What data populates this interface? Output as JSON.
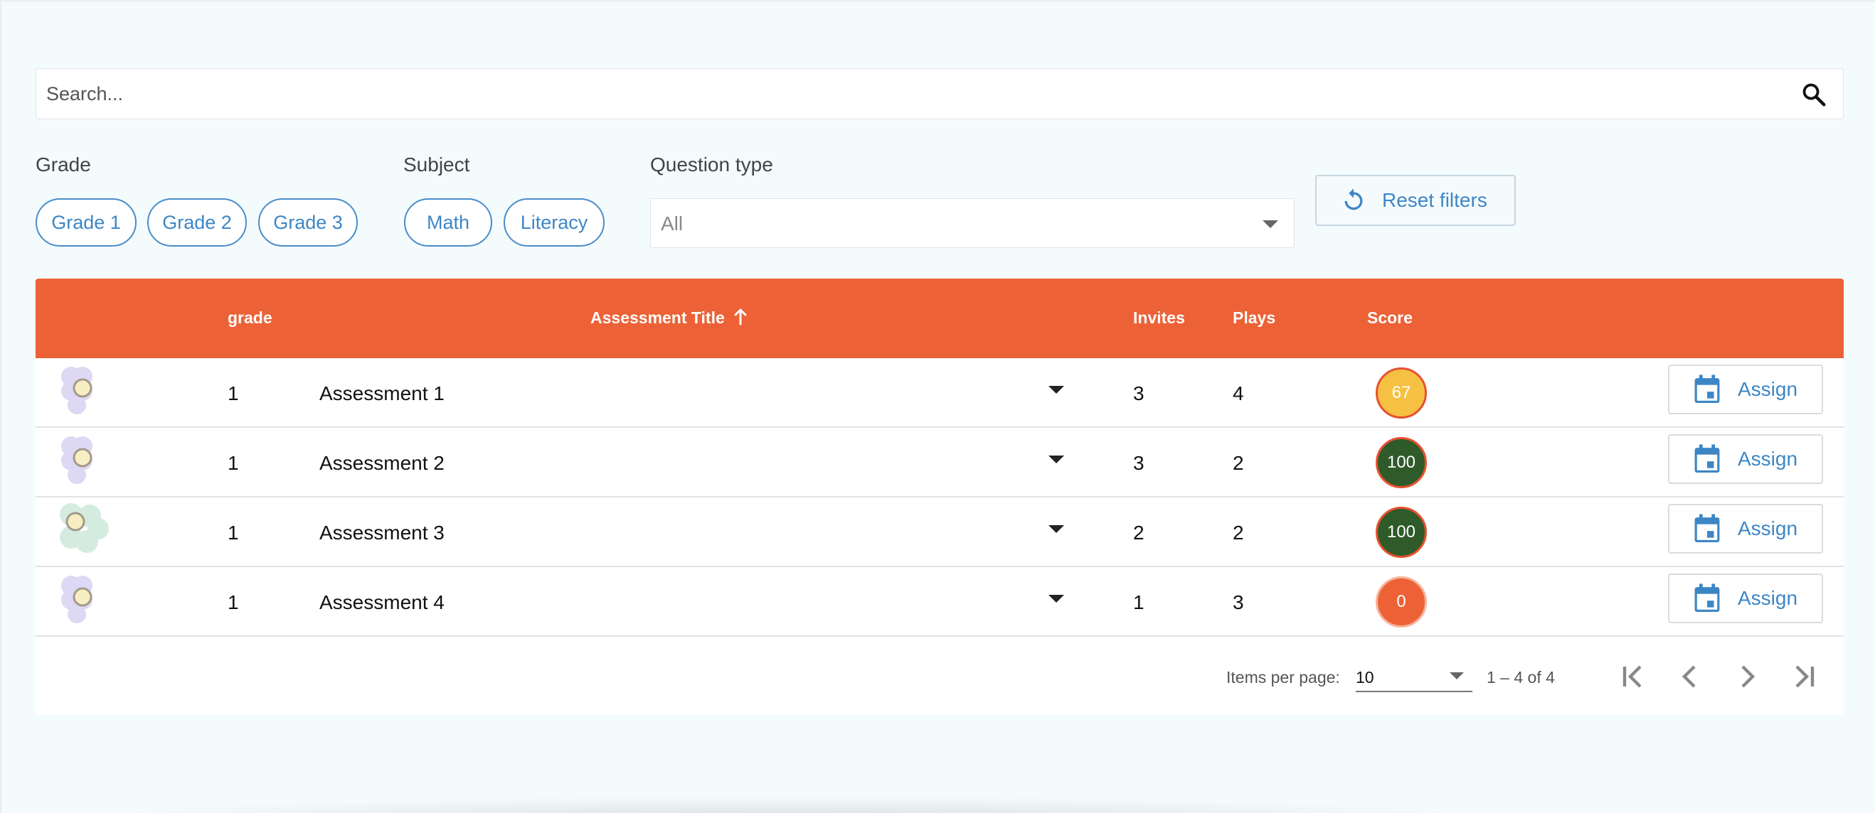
{
  "search": {
    "placeholder": "Search..."
  },
  "filters": {
    "grade": {
      "label": "Grade",
      "chips": [
        "Grade 1",
        "Grade 2",
        "Grade 3"
      ]
    },
    "subject": {
      "label": "Subject",
      "chips": [
        "Math",
        "Literacy"
      ]
    },
    "question_type": {
      "label": "Question type",
      "value": "All"
    },
    "reset_label": "Reset filters"
  },
  "table": {
    "headers": {
      "grade": "grade",
      "title": "Assessment Title",
      "invites": "Invites",
      "plays": "Plays",
      "score": "Score"
    },
    "sort": "ascending",
    "rows": [
      {
        "grade": "1",
        "title": "Assessment 1",
        "invites": "3",
        "plays": "4",
        "score": "67",
        "score_color": "#f6c142",
        "icon_color": "#ddd8f3",
        "assign": "Assign"
      },
      {
        "grade": "1",
        "title": "Assessment 2",
        "invites": "3",
        "plays": "2",
        "score": "100",
        "score_color": "#2f5a2a",
        "icon_color": "#ddd8f3",
        "assign": "Assign"
      },
      {
        "grade": "1",
        "title": "Assessment 3",
        "invites": "2",
        "plays": "2",
        "score": "100",
        "score_color": "#2f5a2a",
        "icon_color": "#d4ecdf",
        "assign": "Assign"
      },
      {
        "grade": "1",
        "title": "Assessment 4",
        "invites": "1",
        "plays": "3",
        "score": "0",
        "score_color": "#ec6236",
        "icon_color": "#ddd8f3",
        "assign": "Assign"
      }
    ]
  },
  "paginator": {
    "items_per_page_label": "Items per page:",
    "items_per_page": "10",
    "range": "1 – 4 of 4"
  },
  "colors": {
    "header": "#ec6236",
    "accent": "#3d86c6",
    "background": "#f3fbfd"
  }
}
